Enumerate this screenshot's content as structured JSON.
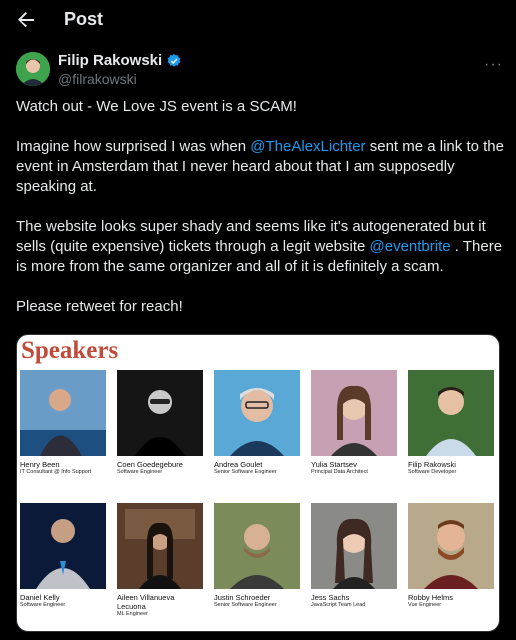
{
  "header": {
    "title": "Post"
  },
  "author": {
    "name": "Filip Rakowski",
    "handle": "@filrakowski"
  },
  "tweet": {
    "line1": "Watch out - We Love JS event is a SCAM!",
    "p2_a": "Imagine how surprised I was when ",
    "p2_mention": "@TheAlexLichter",
    "p2_b": " sent me a link to the event in Amsterdam that I never heard about that I am supposedly speaking at.",
    "p3_a": "The website looks super shady and seems like it's autogenerated but it sells (quite expensive) tickets through a legit website ",
    "p3_mention": "@eventbrite",
    "p3_b": " . There is more from the same organizer and all of it is definitely a scam.",
    "p4": "Please retweet for reach!"
  },
  "media": {
    "heading": "Speakers",
    "speakers": [
      {
        "name": "Henry Been",
        "role": "IT Consultant @ Info Support"
      },
      {
        "name": "Coen Goedegebure",
        "role": "Software Engineer"
      },
      {
        "name": "Andrea Goulet",
        "role": "Senior Software Engineer"
      },
      {
        "name": "Yulia Startsev",
        "role": "Principal Data Architect"
      },
      {
        "name": "Filip Rakowski",
        "role": "Software Developer"
      },
      {
        "name": "Daniel Kelly",
        "role": "Software Engineer"
      },
      {
        "name": "Aileen Villanueva Lecuona",
        "role": "ML Engineer"
      },
      {
        "name": "Justin Schroeder",
        "role": "Senior Software Engineer"
      },
      {
        "name": "Jess Sachs",
        "role": "JavaScript Team Lead"
      },
      {
        "name": "Robby Helms",
        "role": "Vue Engineer"
      }
    ]
  },
  "colors": {
    "accent": "#1d9bf0",
    "heading": "#c04b3a",
    "background": "#000000"
  },
  "icons": {
    "back": "arrow-left-icon",
    "verified": "verified-badge-icon",
    "more": "more-options-icon"
  }
}
